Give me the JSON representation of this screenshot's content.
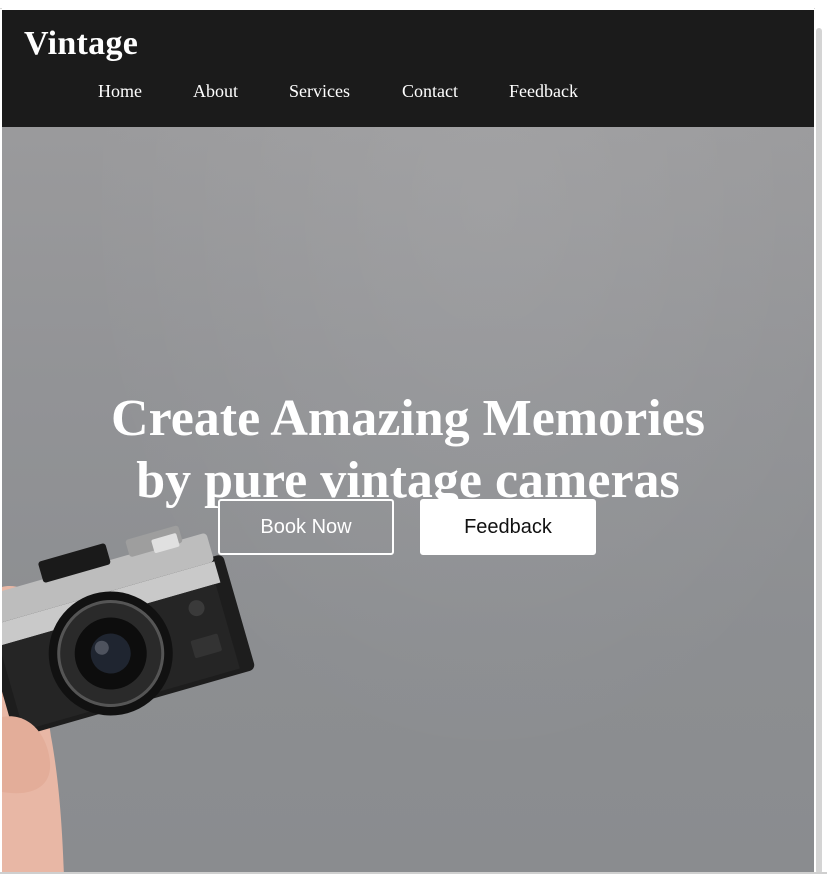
{
  "brand": {
    "title": "Vintage"
  },
  "nav": {
    "items": [
      {
        "label": "Home"
      },
      {
        "label": "About"
      },
      {
        "label": "Services"
      },
      {
        "label": "Contact"
      },
      {
        "label": "Feedback"
      }
    ]
  },
  "hero": {
    "title_line1": "Create Amazing Memories",
    "title_line2": "by pure vintage cameras",
    "buttons": {
      "book_label": "Book Now",
      "feedback_label": "Feedback"
    }
  },
  "colors": {
    "navbar_bg": "#1b1b1b",
    "hero_bg": "#929396",
    "text_light": "#ffffff",
    "button_light_bg": "#ffffff"
  },
  "icons": {
    "camera": "camera-photo-icon"
  }
}
